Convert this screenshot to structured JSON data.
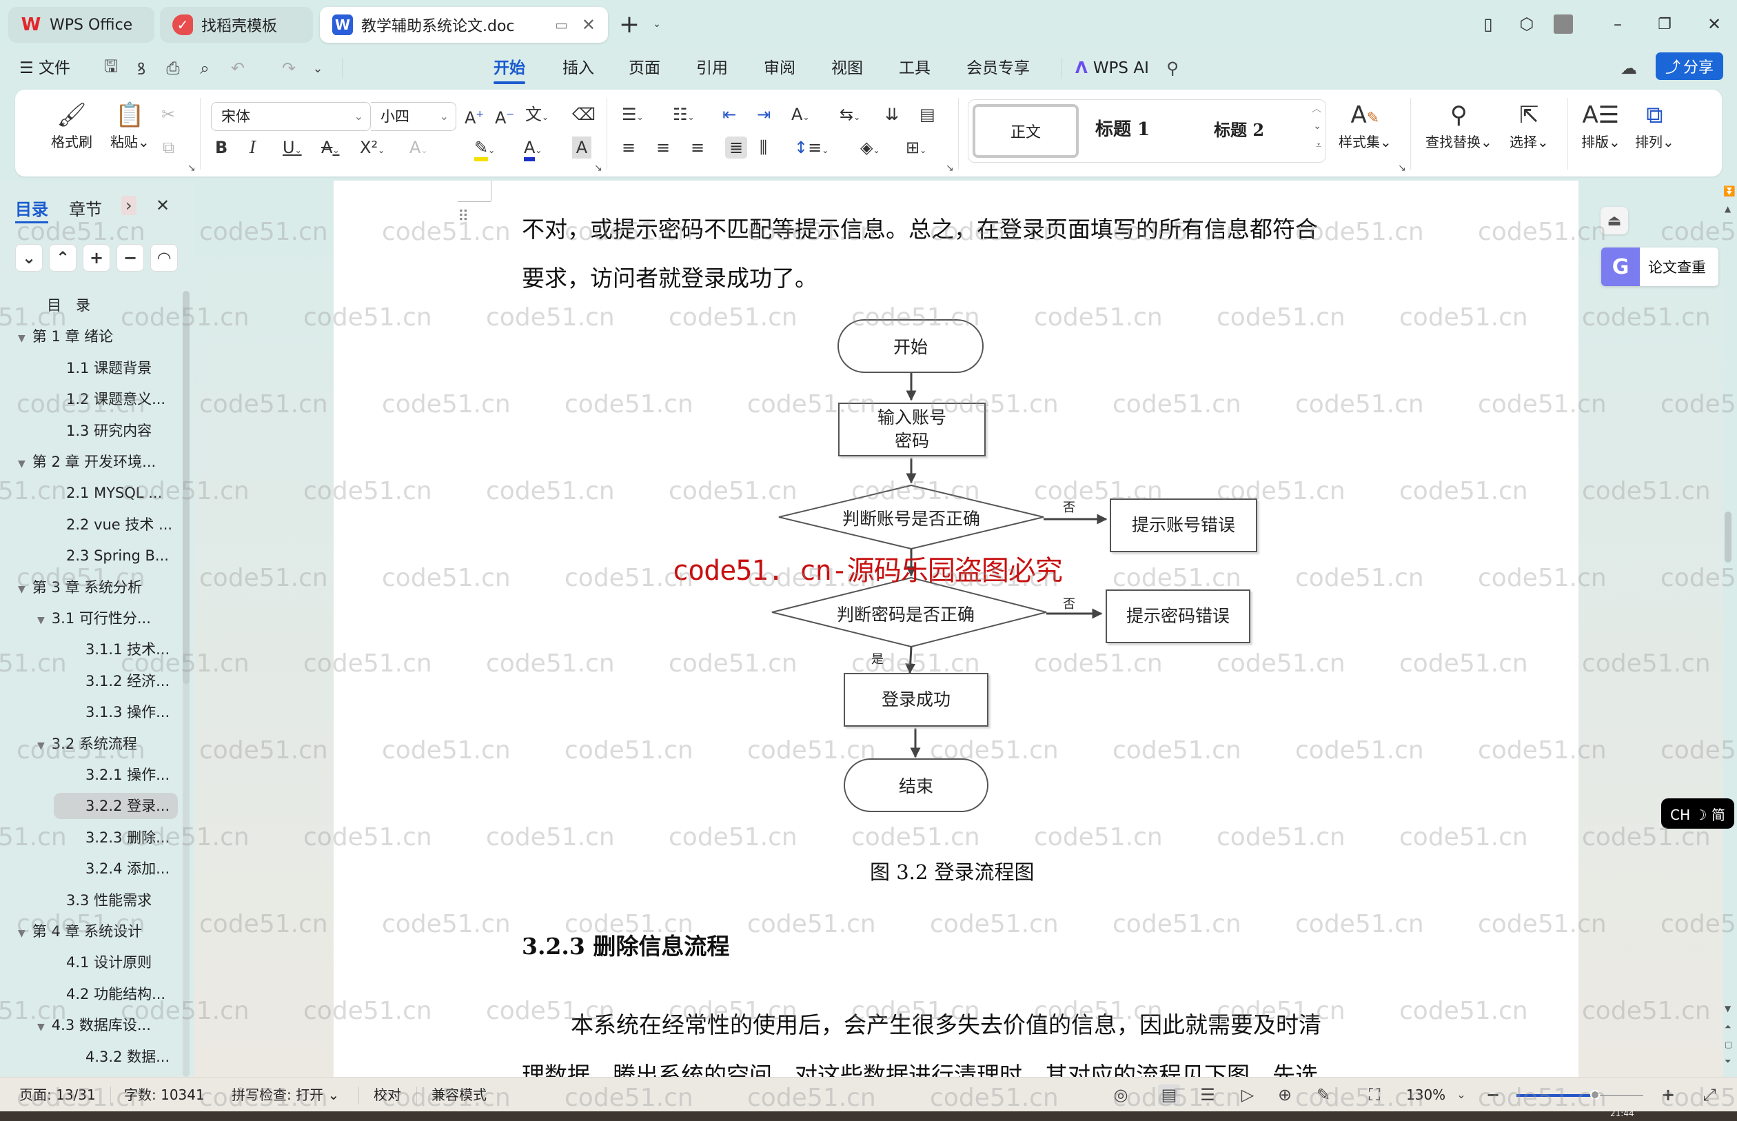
{
  "titlebar": {
    "tabs": [
      {
        "label": "WPS Office",
        "icon": "wps-logo-icon",
        "active": false
      },
      {
        "label": "找稻壳模板",
        "icon": "docer-icon",
        "active": false
      },
      {
        "label": "教学辅助系统论文.doc",
        "icon": "word-doc-icon",
        "active": true
      }
    ],
    "new_tab_label": "+",
    "window_controls": [
      "minimize",
      "maximize",
      "close"
    ]
  },
  "menubar": {
    "file_label": "文件",
    "items": [
      "开始",
      "插入",
      "页面",
      "引用",
      "审阅",
      "视图",
      "工具",
      "会员专享"
    ],
    "active_item": "开始",
    "wps_ai_label": "WPS AI",
    "share_label": "分享"
  },
  "ribbon": {
    "format_painter_label": "格式刷",
    "paste_label": "粘贴",
    "font_name": "宋体",
    "font_size": "小四",
    "styles": [
      "正文",
      "标题 1",
      "标题 2"
    ],
    "style_set_label": "样式集",
    "find_replace_label": "查找替换",
    "select_label": "选择",
    "layout_label": "排版",
    "arrange_label": "排列",
    "colors": {
      "highlight": "#f5e000",
      "font_color": "#1a2fc8"
    }
  },
  "nav": {
    "tabs": [
      "目录",
      "章节"
    ],
    "active_tab": "目录",
    "toc": [
      {
        "label": "目　录",
        "level": 0,
        "toggle": false
      },
      {
        "label": "第 1 章  绪论",
        "level": 0,
        "toggle": true
      },
      {
        "label": "1.1  课题背景",
        "level": 1,
        "toggle": false
      },
      {
        "label": "1.2  课题意义...",
        "level": 1,
        "toggle": false
      },
      {
        "label": "1.3  研究内容",
        "level": 1,
        "toggle": false
      },
      {
        "label": "第 2 章  开发环境...",
        "level": 0,
        "toggle": true
      },
      {
        "label": "2.1 MYSQL ...",
        "level": 1,
        "toggle": false
      },
      {
        "label": "2.2 vue 技术  ...",
        "level": 1,
        "toggle": false
      },
      {
        "label": "2.3 Spring B...",
        "level": 1,
        "toggle": false
      },
      {
        "label": "第 3 章  系统分析",
        "level": 0,
        "toggle": true
      },
      {
        "label": "3.1  可行性分...",
        "level": 1,
        "toggle": true
      },
      {
        "label": "3.1.1  技术...",
        "level": 2,
        "toggle": false
      },
      {
        "label": "3.1.2  经济...",
        "level": 2,
        "toggle": false
      },
      {
        "label": "3.1.3  操作...",
        "level": 2,
        "toggle": false
      },
      {
        "label": "3.2  系统流程",
        "level": 1,
        "toggle": true
      },
      {
        "label": "3.2.1  操作...",
        "level": 2,
        "toggle": false
      },
      {
        "label": "3.2.2  登录...",
        "level": 2,
        "toggle": false,
        "selected": true
      },
      {
        "label": "3.2.3  删除...",
        "level": 2,
        "toggle": false
      },
      {
        "label": "3.2.4  添加...",
        "level": 2,
        "toggle": false
      },
      {
        "label": "3.3  性能需求",
        "level": 1,
        "toggle": false
      },
      {
        "label": "第 4 章  系统设计",
        "level": 0,
        "toggle": true
      },
      {
        "label": "4.1  设计原则",
        "level": 1,
        "toggle": false
      },
      {
        "label": "4.2  功能结构...",
        "level": 1,
        "toggle": false
      },
      {
        "label": "4.3  数据库设...",
        "level": 1,
        "toggle": true
      },
      {
        "label": "4.3.2  数据...",
        "level": 2,
        "toggle": false
      }
    ]
  },
  "document": {
    "para1_line1": "不对，或提示密码不匹配等提示信息。总之，在登录页面填写的所有信息都符合",
    "para1_line2": "要求，访问者就登录成功了。",
    "flowchart": {
      "start": "开始",
      "input": "输入账号\n密码",
      "check_account": "判断账号是否正确",
      "account_error": "提示账号错误",
      "check_password": "判断密码是否正确",
      "password_error": "提示密码错误",
      "success": "登录成功",
      "end": "结束",
      "no_label": "否",
      "yes_label": "是"
    },
    "figure_caption": "图 3.2  登录流程图",
    "section_heading": "3.2.3  删除信息流程",
    "para2_line1": "本系统在经常性的使用后，会产生很多失去价值的信息，因此就需要及时清",
    "para2_line2": "理数据，腾出系统的空间。对这些数据进行清理时，其对应的流程见下图。先选",
    "overlay_watermark": "code51. cn-源码乐园盗图必究",
    "watermark": "code51.cn"
  },
  "right_panel": {
    "plagiarism_label": "论文查重",
    "ime_label": "CH ☽ 简"
  },
  "statusbar": {
    "page": "页面: 13/31",
    "word_count": "字数: 10341",
    "spell_check": "拼写检查: 打开",
    "proofread": "校对",
    "compat_mode": "兼容模式",
    "zoom": "130%",
    "zoom_fraction": 0.62,
    "clock": "21:44"
  }
}
